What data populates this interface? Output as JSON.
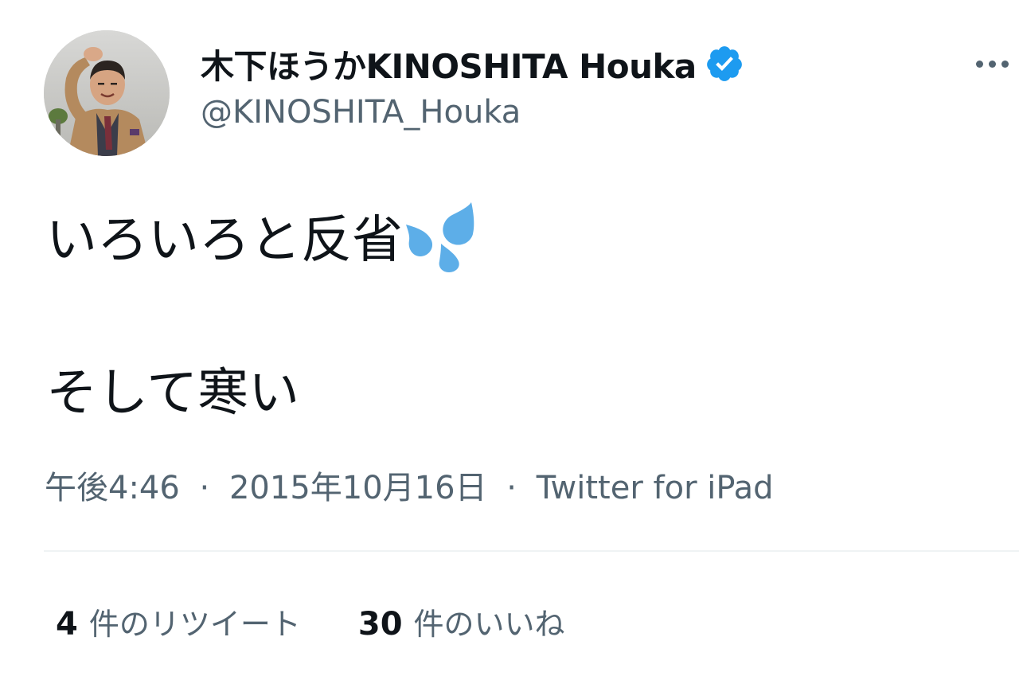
{
  "user": {
    "display_name": "木下ほうかKINOSHITA Houka",
    "handle": "@KINOSHITA_Houka",
    "verified": true
  },
  "tweet": {
    "line1": "いろいろと反省",
    "line1_emoji": "sweat-droplets-emoji",
    "line2": "そして寒い"
  },
  "meta": {
    "time": "午後4:46",
    "separator": "·",
    "date": "2015年10月16日",
    "source": "Twitter for iPad"
  },
  "stats": {
    "retweets_count": "4",
    "retweets_label": "件のリツイート",
    "likes_count": "30",
    "likes_label": "件のいいね"
  },
  "colors": {
    "primary_text": "#0f1419",
    "secondary_text": "#536471",
    "verified_blue": "#1d9bf0",
    "emoji_blue": "#5daee8",
    "divider": "#eff3f4"
  },
  "icons": {
    "verified": "verified-badge-icon",
    "more": "more-options-icon"
  }
}
